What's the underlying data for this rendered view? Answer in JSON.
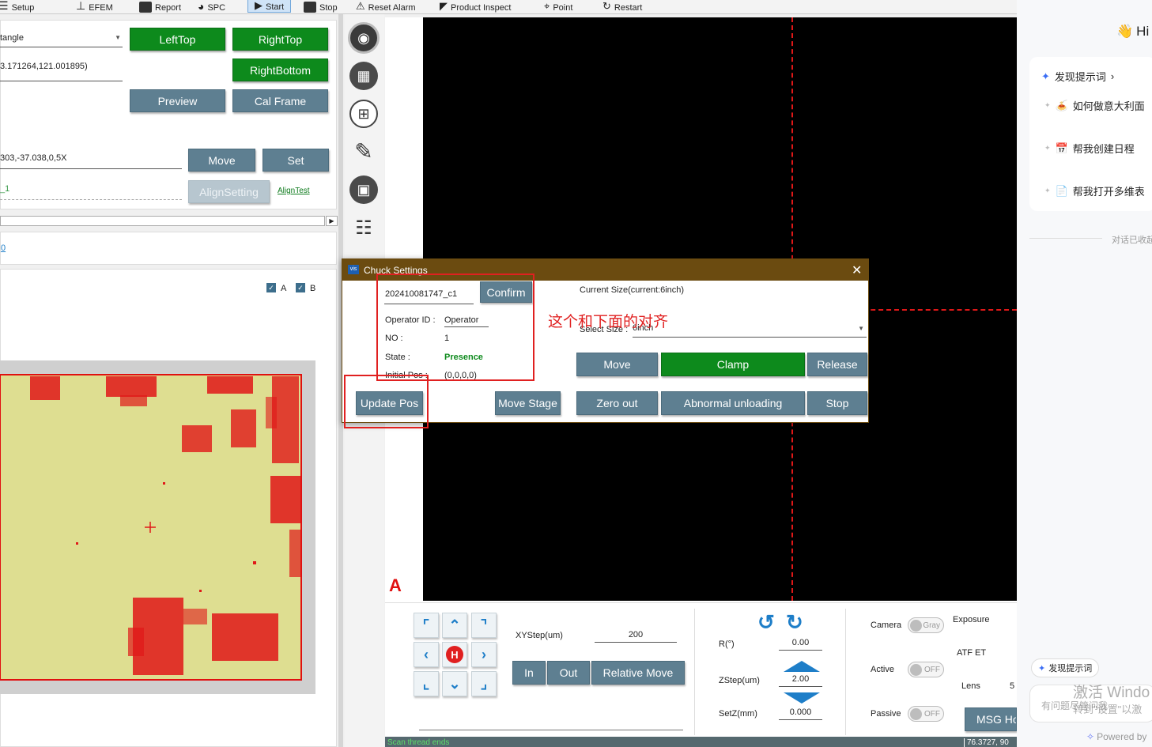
{
  "toolbar": {
    "items": [
      {
        "label": "Setup"
      },
      {
        "label": "EFEM"
      },
      {
        "label": "Report"
      },
      {
        "label": "SPC"
      },
      {
        "label": "Start"
      },
      {
        "label": "Stop"
      },
      {
        "label": "Reset Alarm"
      },
      {
        "label": "Product Inspect"
      },
      {
        "label": "Point"
      },
      {
        "label": "Restart"
      }
    ]
  },
  "left": {
    "shape_select": "tangle",
    "coord_value": "3.171264,121.001895)",
    "buttons": {
      "lefttop": "LeftTop",
      "righttop": "RightTop",
      "rightbottom": "RightBottom",
      "preview": "Preview",
      "calframe": "Cal Frame",
      "move": "Move",
      "set": "Set",
      "alignsetting": "AlignSetting",
      "aligntest": "AlignTest"
    },
    "pos_value": "303,-37.038,0,5X",
    "align_value": "_1",
    "link_text": "0",
    "check_a": "A",
    "check_b": "B"
  },
  "viewer": {
    "label": "A"
  },
  "dialog": {
    "title": "Chuck Settings",
    "wafer_id": "202410081747_c1",
    "confirm": "Confirm",
    "operator_label": "Operator ID :",
    "operator_value": "Operator",
    "no_label": "NO :",
    "no_value": "1",
    "state_label": "State :",
    "state_value": "Presence",
    "initpos_label": "Initial Pos :",
    "initpos_value": "(0,0,0,0)",
    "current_size": "Current Size(current:6inch)",
    "select_size_label": "Select Size :",
    "select_size_value": "6inch",
    "annotation": "这个和下面的对齐",
    "buttons": {
      "move": "Move",
      "clamp": "Clamp",
      "release": "Release",
      "update_pos": "Update Pos",
      "move_stage": "Move Stage",
      "zero_out": "Zero out",
      "abnormal": "Abnormal unloading",
      "stop": "Stop"
    },
    "colors": {
      "titlebar": "#6b4b10",
      "highlight": "#e02020"
    }
  },
  "control": {
    "xystep_label": "XYStep(um)",
    "xystep_value": "200",
    "in": "In",
    "out": "Out",
    "relative_move": "Relative Move",
    "r_label": "R(°)",
    "r_value": "0.00",
    "zstep_label": "ZStep(um)",
    "zstep_value": "2.00",
    "setz_label": "SetZ(mm)",
    "setz_value": "0.000",
    "camera_label": "Camera",
    "camera_toggle": "Gray",
    "active_label": "Active",
    "active_toggle": "OFF",
    "passive_label": "Passive",
    "passive_toggle": "OFF",
    "exposure_label": "Exposure",
    "atfet_label": "ATF ET",
    "lens_label": "Lens",
    "lens_value": "5",
    "msg_button": "MSG Ho",
    "home_glyph": "H"
  },
  "status": {
    "left": "Scan thread ends",
    "right": "76.3727, 90"
  },
  "right_panel": {
    "greeting": "Hi",
    "discover": "发现提示词",
    "suggestions": [
      {
        "label": "如何做意大利面"
      },
      {
        "label": "帮我创建日程"
      },
      {
        "label": "帮我打开多维表"
      }
    ],
    "collapsed_note": "对话已收起",
    "discover_small": "发现提示词",
    "input_placeholder": "有问题尽管问我",
    "watermark_1": "激活 Windo",
    "watermark_2": "转到\"设置\"以激",
    "powered": "Powered by"
  }
}
